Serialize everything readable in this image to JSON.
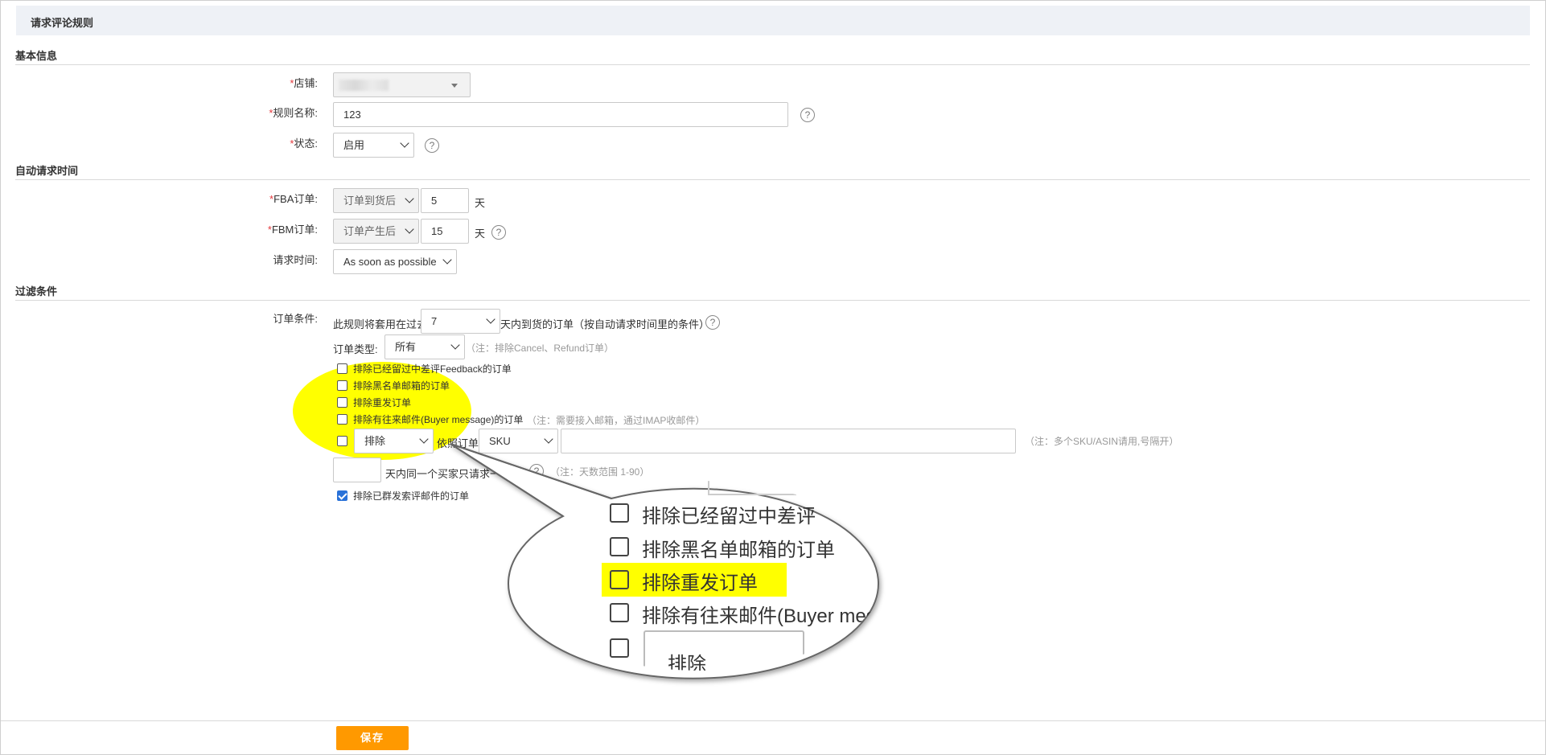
{
  "page": {
    "title": "请求评论规则"
  },
  "sections": {
    "basic": "基本信息",
    "auto_time": "自动请求时间",
    "filter": "过滤条件"
  },
  "basic": {
    "store_label": "店铺:",
    "rule_name_label": "规则名称:",
    "rule_name_value": "123",
    "status_label": "状态:",
    "status_value": "启用"
  },
  "auto_time": {
    "fba_label": "FBA订单:",
    "fba_select": "订单到货后",
    "fba_days": "5",
    "fbm_label": "FBM订单:",
    "fbm_select": "订单产生后",
    "fbm_days": "15",
    "day_unit": "天",
    "request_time_label": "请求时间:",
    "request_time_value": "As soon as possible"
  },
  "filter": {
    "order_cond_label": "订单条件:",
    "rule_prefix": "此规则将套用在过去",
    "past_days": "7",
    "rule_suffix": "天内到货的订单（按自动请求时间里的条件）",
    "order_type_label": "订单类型:",
    "order_type_value": "所有",
    "order_type_note": "（注：排除Cancel、Refund订单）",
    "checkboxes": [
      {
        "label": "排除已经留过中差评Feedback的订单",
        "checked": false
      },
      {
        "label": "排除黑名单邮箱的订单",
        "checked": false
      },
      {
        "label": "排除重发订单",
        "checked": false
      },
      {
        "label": "排除有往来邮件(Buyer message)的订单",
        "checked": false
      }
    ],
    "buyer_message_note": "（注：需要接入邮箱，通过IMAP收邮件）",
    "sku_mode": "排除",
    "sku_by": "依照订单",
    "sku_type": "SKU",
    "sku_note": "（注：多个SKU/ASIN请用,号隔开）",
    "once_text": "天内同一个买家只请求一次",
    "once_note": "（注：天数范围 1-90）",
    "exclude_mass_label": "排除已群发索评邮件的订单",
    "exclude_mass_checked": true
  },
  "zoom": {
    "lines": [
      "排除已经留过中差评",
      "排除黑名单邮箱的订单",
      "排除重发订单",
      "排除有往来邮件(Buyer mes"
    ],
    "select": "排除"
  },
  "footer": {
    "save_label": "保存"
  },
  "colors": {
    "accent": "#ff9900",
    "highlight": "#ffff00",
    "checkbox_checked": "#2a72d8"
  }
}
